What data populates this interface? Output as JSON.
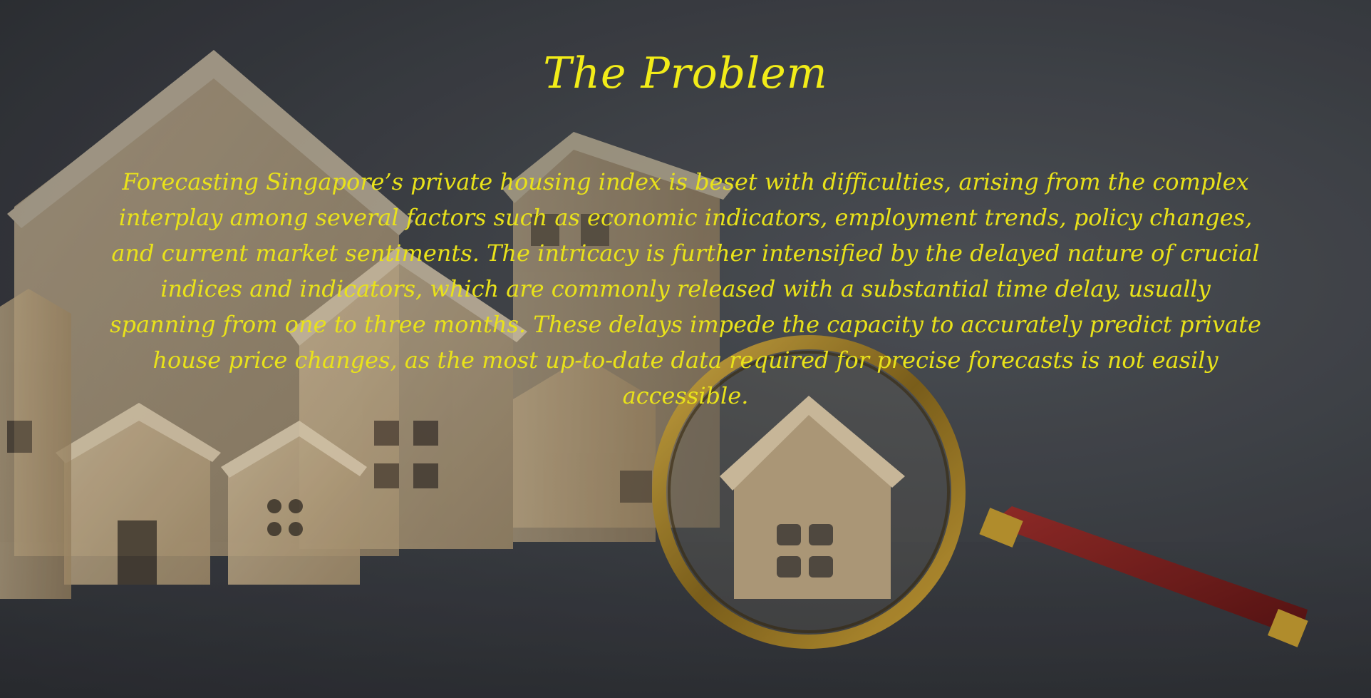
{
  "slide": {
    "title": "The Problem",
    "body": "Forecasting Singapore’s private housing index is beset with difficulties, arising from the complex interplay among several factors such as economic indicators, employment trends, policy changes, and current market sentiments. The intricacy is further intensified by the delayed nature of crucial indices and indicators, which are commonly released with a substantial time delay, usually spanning from one to three months. These delays impede the capacity to accurately predict private house price changes, as the most up-to-date data required for precise forecasts is not easily accessible."
  },
  "colors": {
    "text_accent": "#f2ec18",
    "background": "#3e4147",
    "wood": "#cdb894",
    "magnifier_handle": "#8e1f1f",
    "magnifier_rim": "#b08a2a"
  },
  "background_image": {
    "icons": [
      "wooden-house-icon",
      "magnifying-glass-icon"
    ]
  }
}
